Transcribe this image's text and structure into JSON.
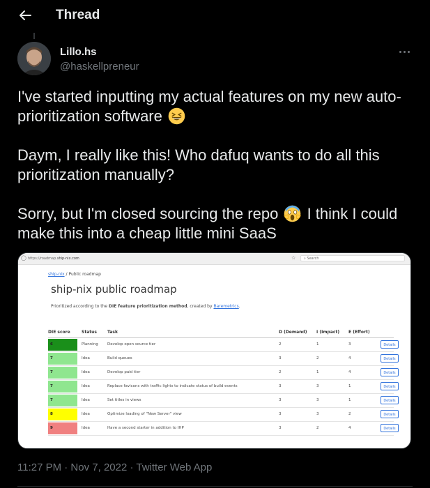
{
  "header": {
    "title": "Thread",
    "back_icon": "back-arrow-icon"
  },
  "author": {
    "name": "Lillo.hs",
    "handle": "@haskellpreneur"
  },
  "tweet": {
    "para1": "I've started inputting my actual features on my new auto-prioritization software",
    "para2": "Daym, I really like this! Who dafuq wants to do all this prioritization manually?",
    "para3a": "Sorry, but I'm closed sourcing the repo",
    "para3b": "I think I could make this into a cheap little mini SaaS",
    "emoji1": "grinning-squinting-face",
    "emoji2": "face-screaming-in-fear"
  },
  "screenshot": {
    "browser": {
      "url_prefix": "https://roadmap.",
      "url_host": "ship-nix.com",
      "search_placeholder": "Search"
    },
    "breadcrumb": {
      "root": "ship-nix",
      "sep": " / ",
      "current": "Public roadmap"
    },
    "title": "ship-nix public roadmap",
    "subtitle": {
      "prefix": "Prioritized according to the ",
      "bold": "DIE feature prioritization method",
      "mid": ", created by ",
      "link": "Baremetrics",
      "suffix": "."
    },
    "columns": [
      "DIE score",
      "Status",
      "Task",
      "D (Demand)",
      "I (Impact)",
      "E (Effort)"
    ],
    "details_label": "Details",
    "rows": [
      {
        "score": "6",
        "status": "Planning",
        "task": "Develop open source tier",
        "d": "2",
        "i": "1",
        "e": "3",
        "color": "#1a8f1a"
      },
      {
        "score": "7",
        "status": "Idea",
        "task": "Build queues",
        "d": "3",
        "i": "2",
        "e": "4",
        "color": "#8fe68f"
      },
      {
        "score": "7",
        "status": "Idea",
        "task": "Develop paid tier",
        "d": "2",
        "i": "1",
        "e": "4",
        "color": "#8fe68f"
      },
      {
        "score": "7",
        "status": "Idea",
        "task": "Replace favicons with traffic lights to indicate status of build events",
        "d": "3",
        "i": "3",
        "e": "1",
        "color": "#8fe68f"
      },
      {
        "score": "7",
        "status": "Idea",
        "task": "Set titles in views",
        "d": "3",
        "i": "3",
        "e": "1",
        "color": "#8fe68f"
      },
      {
        "score": "8",
        "status": "Idea",
        "task": "Optimize loading of \"New Server\" view",
        "d": "3",
        "i": "3",
        "e": "2",
        "color": "#ffff00"
      },
      {
        "score": "9",
        "status": "Idea",
        "task": "Have a second starter in addition to IHP",
        "d": "3",
        "i": "2",
        "e": "4",
        "color": "#f08080"
      }
    ]
  },
  "meta": {
    "timestamp": "11:27 PM · Nov 7, 2022 · Twitter Web App"
  }
}
